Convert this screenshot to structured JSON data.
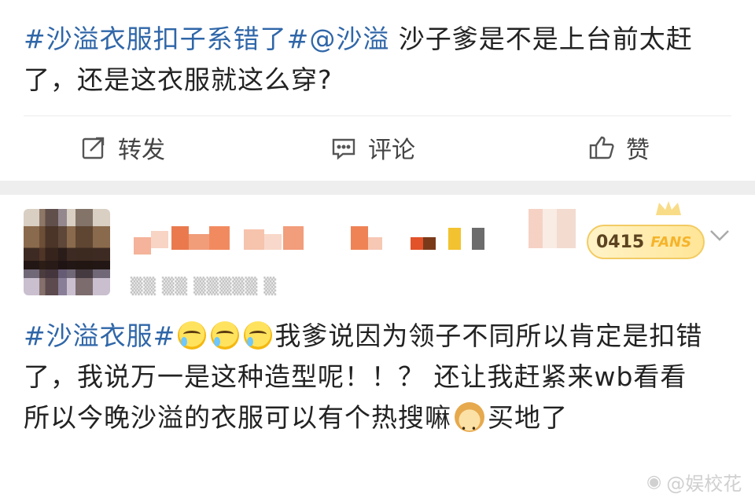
{
  "top_post": {
    "tag": "#沙溢衣服扣子系错了#",
    "mention": "@沙溢",
    "text": " 沙子爹是不是上台前太赶了，还是这衣服就这么穿?",
    "actions": {
      "repost_label": "转发",
      "comment_label": "评论",
      "like_label": "赞"
    }
  },
  "comment_post": {
    "fan_badge": {
      "number": "0415",
      "label": "FANS"
    },
    "tag": "#沙溢衣服#",
    "line1": "我爹说因为领子不同所以肯定是扣错了，我说万一是这种造型呢！！？ 还让我赶紧来wb看看",
    "line2_before": "所以今晚沙溢的衣服可以有个热搜嘛",
    "line2_after": "买地了"
  },
  "watermark": {
    "text": "@娱校花"
  },
  "colors": {
    "link": "#2f66a8",
    "badge_gold": "#f5b42b"
  },
  "icons": [
    "repost-icon",
    "comment-icon",
    "like-icon",
    "crown-icon",
    "chevron-down-icon",
    "laugh-cry-emoji",
    "doge-emoji",
    "weibo-logo-icon"
  ]
}
